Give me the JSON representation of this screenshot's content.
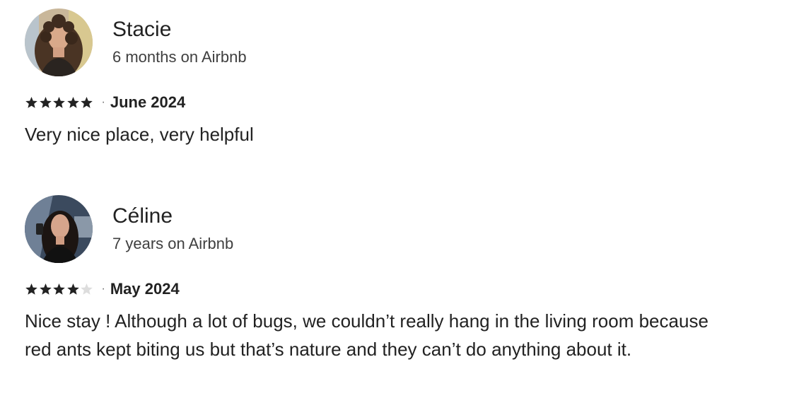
{
  "reviews": [
    {
      "name": "Stacie",
      "tenure": "6 months on Airbnb",
      "rating": 5,
      "max_rating": 5,
      "separator": "·",
      "date": "June 2024",
      "text": "Very nice place, very helpful"
    },
    {
      "name": "Céline",
      "tenure": "7 years on Airbnb",
      "rating": 4,
      "max_rating": 5,
      "separator": "·",
      "date": "May 2024",
      "text": "Nice stay ! Although a lot of bugs, we couldn’t really hang in the living room because red ants kept biting us but that’s nature and they can’t do anything about it."
    }
  ],
  "colors": {
    "text": "#222222",
    "secondary_text": "#3f3f3f",
    "star_filled": "#222222",
    "star_empty": "#dddddd"
  },
  "icons": {
    "star": "star-icon"
  }
}
